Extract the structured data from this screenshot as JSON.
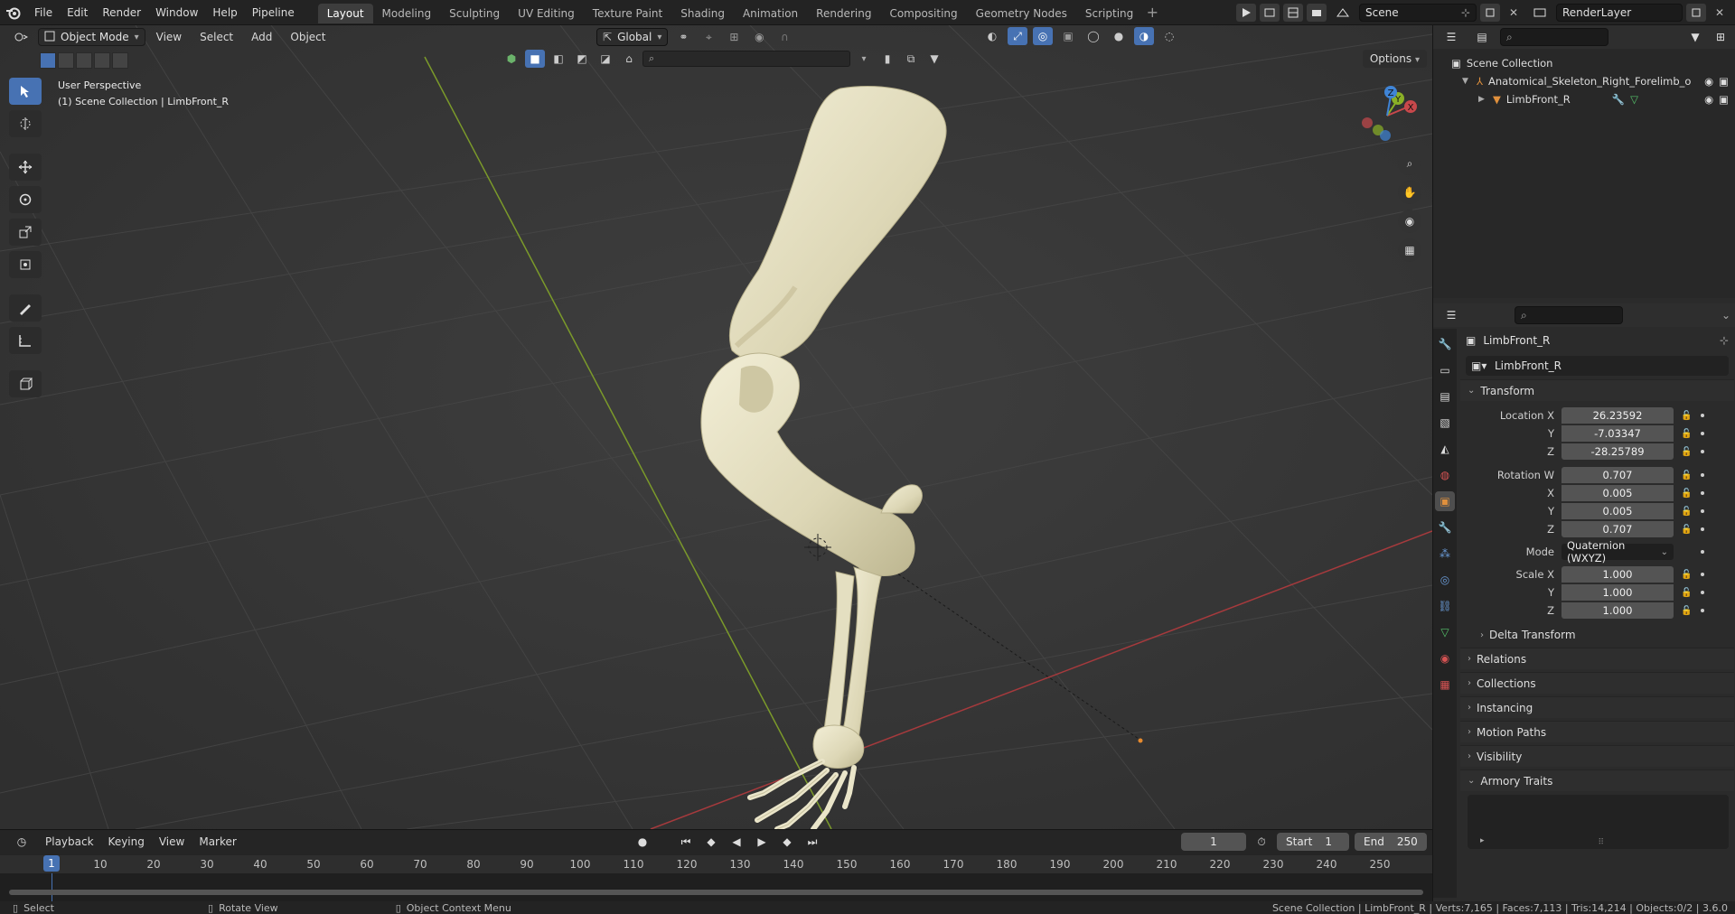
{
  "topbar": {
    "menus": [
      "File",
      "Edit",
      "Render",
      "Window",
      "Help",
      "Pipeline"
    ],
    "workspaces": [
      "Layout",
      "Modeling",
      "Sculpting",
      "UV Editing",
      "Texture Paint",
      "Shading",
      "Animation",
      "Rendering",
      "Compositing",
      "Geometry Nodes",
      "Scripting"
    ],
    "active_workspace": "Layout",
    "scene_name": "Scene",
    "view_layer": "RenderLayer"
  },
  "viewport": {
    "mode": "Object Mode",
    "menus": [
      "View",
      "Select",
      "Add",
      "Object"
    ],
    "transform_orientation": "Global",
    "options_label": "Options",
    "info_line1": "User Perspective",
    "info_line2": "(1) Scene Collection | LimbFront_R"
  },
  "outliner": {
    "root": "Scene Collection",
    "items": [
      {
        "label": "Anatomical_Skeleton_Right_Forelimb_o"
      },
      {
        "label": "LimbFront_R"
      }
    ]
  },
  "properties": {
    "object_title": "LimbFront_R",
    "object_name": "LimbFront_R",
    "transform_header": "Transform",
    "location": {
      "label": "Location X",
      "x": "26.23592",
      "y": "-7.03347",
      "z": "-28.25789"
    },
    "rotation": {
      "label": "Rotation W",
      "w": "0.707",
      "x": "0.005",
      "y": "0.005",
      "z": "0.707"
    },
    "mode_label": "Mode",
    "mode_value": "Quaternion (WXYZ)",
    "scale": {
      "label": "Scale X",
      "x": "1.000",
      "y": "1.000",
      "z": "1.000"
    },
    "axis": {
      "x": "X",
      "y": "Y",
      "z": "Z"
    },
    "delta_transform": "Delta Transform",
    "panels": [
      "Relations",
      "Collections",
      "Instancing",
      "Motion Paths",
      "Visibility"
    ],
    "armory_traits": "Armory Traits"
  },
  "timeline": {
    "menus": [
      "Playback",
      "Keying",
      "View",
      "Marker"
    ],
    "current_frame": "1",
    "start_label": "Start",
    "start": "1",
    "end_label": "End",
    "end": "250",
    "ticks": [
      "10",
      "20",
      "30",
      "40",
      "50",
      "60",
      "70",
      "80",
      "90",
      "100",
      "110",
      "120",
      "130",
      "140",
      "150",
      "160",
      "170",
      "180",
      "190",
      "200",
      "210",
      "220",
      "230",
      "240",
      "250"
    ]
  },
  "statusbar": {
    "select": "Select",
    "rotate_view": "Rotate View",
    "context_menu": "Object Context Menu",
    "stats": "Scene Collection | LimbFront_R | Verts:7,165 | Faces:7,113 | Tris:14,214 | Objects:0/2 | 3.6.0"
  },
  "colors": {
    "accent": "#4772b3",
    "x_axis": "#c8484b",
    "y_axis": "#8ab027",
    "z_axis": "#3f84d6",
    "bone": "#e6e1c4"
  }
}
